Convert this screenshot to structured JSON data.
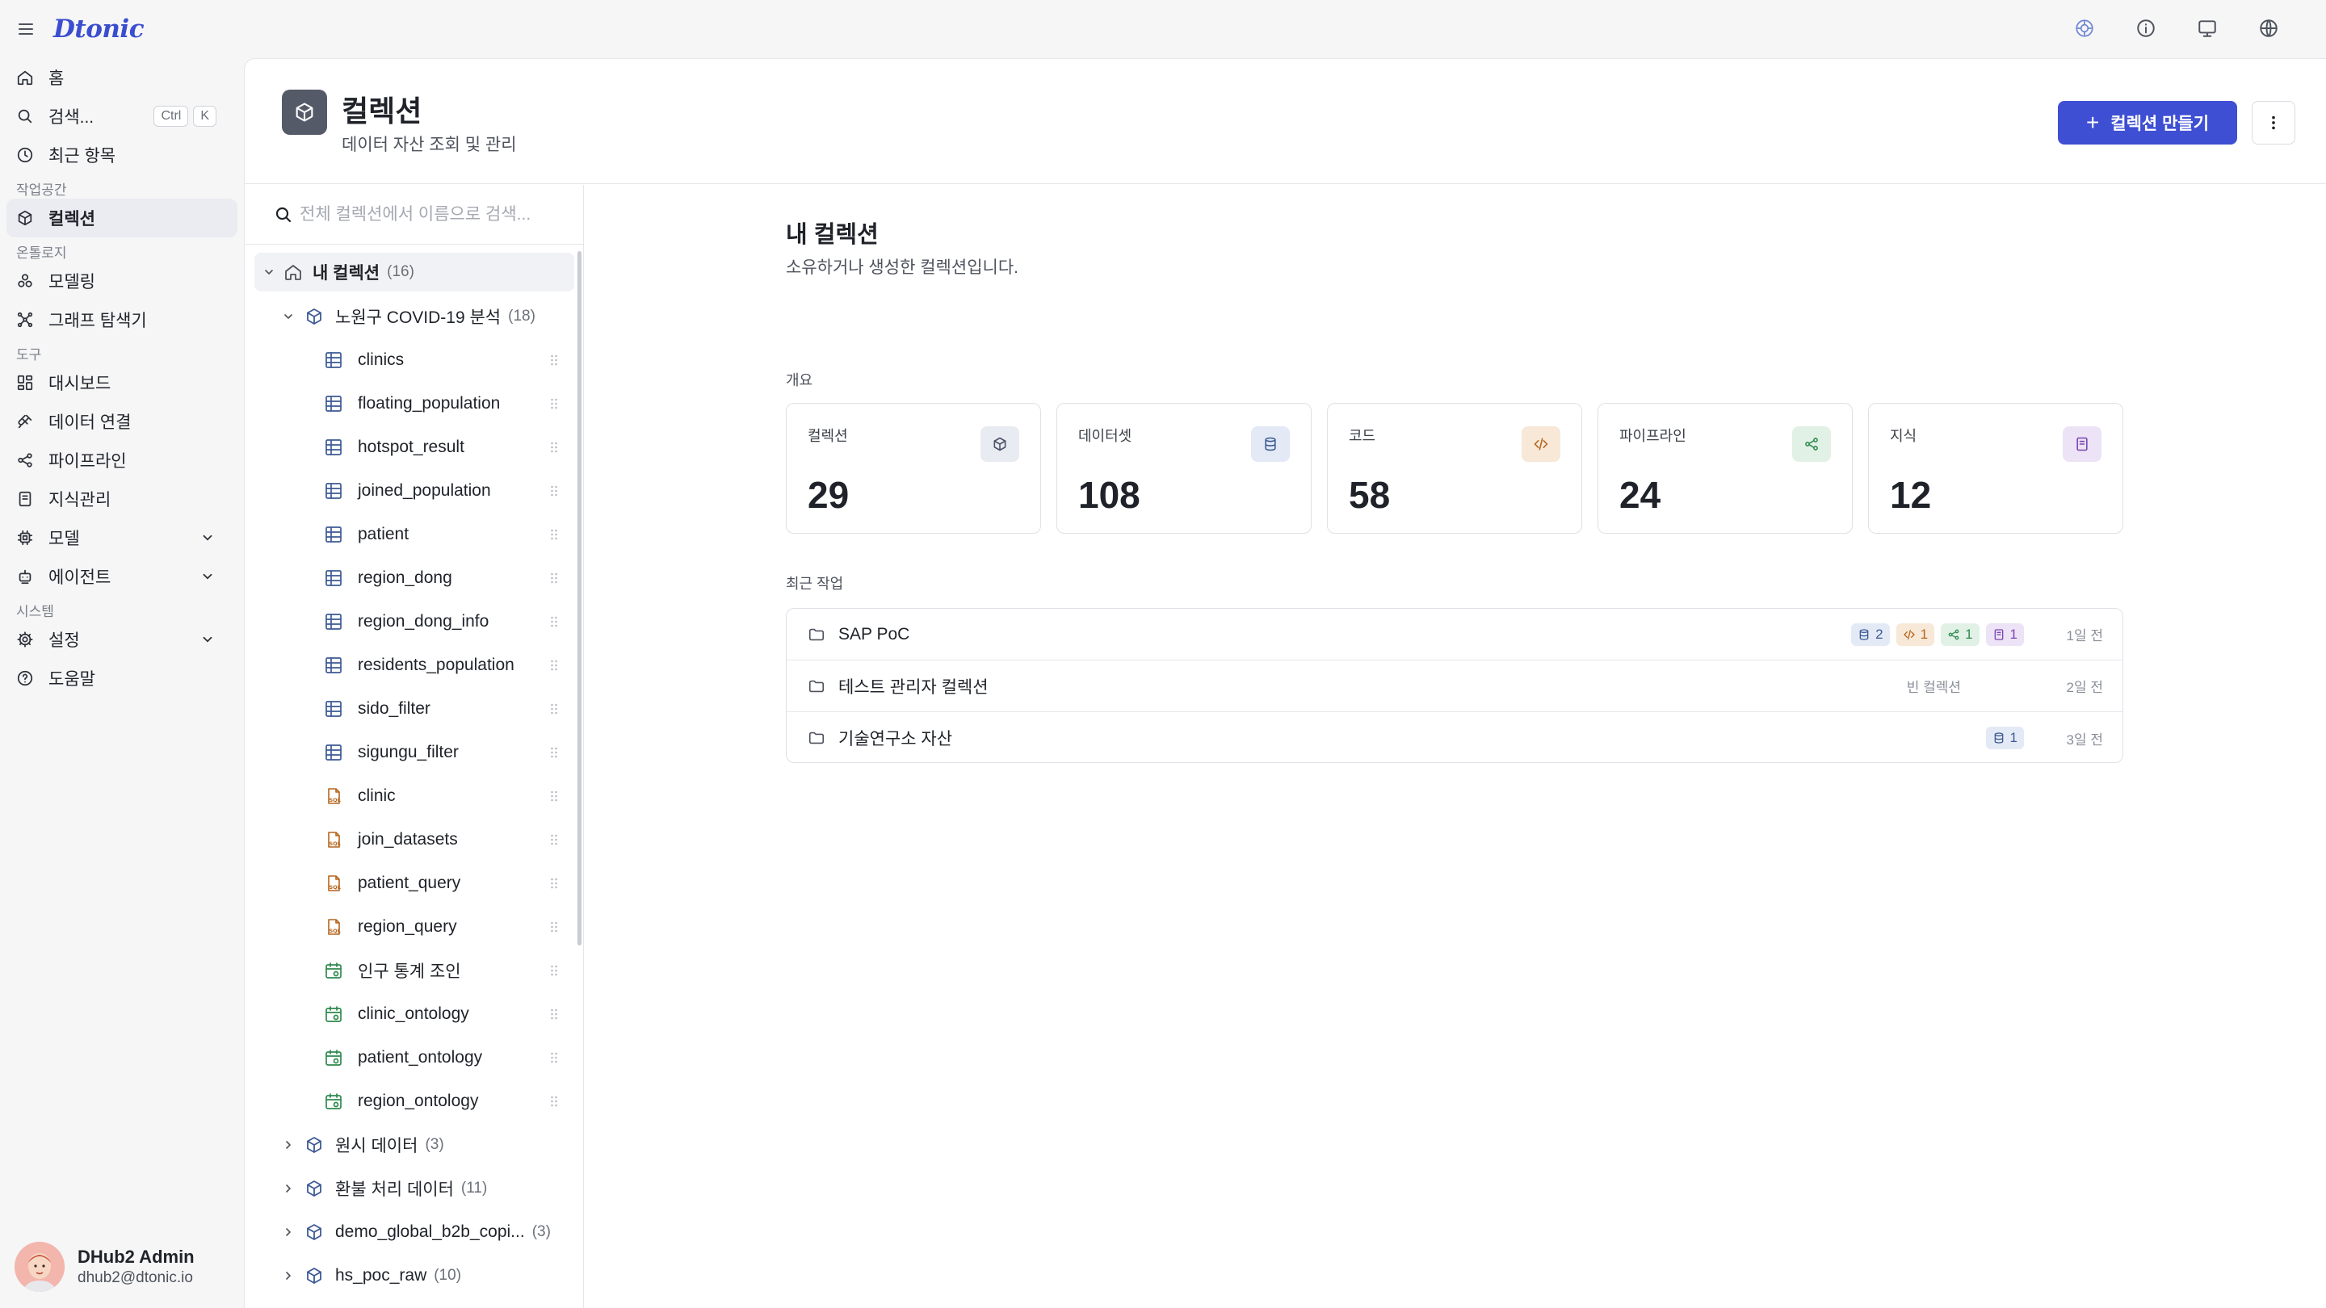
{
  "app": {
    "logo": "Dtonic"
  },
  "sidebar": {
    "nav_top": [
      {
        "label": "홈",
        "icon": "home-icon"
      },
      {
        "label": "검색...",
        "icon": "search-icon",
        "shortcut": [
          "Ctrl",
          "K"
        ]
      },
      {
        "label": "최근 항목",
        "icon": "clock-icon"
      }
    ],
    "section_workspace": "작업공간",
    "workspace_items": [
      {
        "label": "컬렉션",
        "icon": "cube-icon",
        "active": true
      }
    ],
    "section_ontology": "온톨로지",
    "ontology_items": [
      {
        "label": "모델링",
        "icon": "modeling-icon"
      },
      {
        "label": "그래프 탐색기",
        "icon": "graph-icon"
      }
    ],
    "section_tools": "도구",
    "tool_items": [
      {
        "label": "대시보드",
        "icon": "dashboard-icon"
      },
      {
        "label": "데이터 연결",
        "icon": "plug-icon"
      },
      {
        "label": "파이프라인",
        "icon": "pipeline-icon"
      },
      {
        "label": "지식관리",
        "icon": "book-icon"
      },
      {
        "label": "모델",
        "icon": "chip-icon",
        "expandable": true
      },
      {
        "label": "에이전트",
        "icon": "robot-icon",
        "expandable": true
      }
    ],
    "section_system": "시스템",
    "system_items": [
      {
        "label": "설정",
        "icon": "gear-icon",
        "expandable": true
      },
      {
        "label": "도움말",
        "icon": "help-icon"
      }
    ],
    "user": {
      "name": "DHub2 Admin",
      "email": "dhub2@dtonic.io"
    }
  },
  "header": {
    "title": "컬렉션",
    "subtitle": "데이터 자산 조회 및 관리",
    "create_label": "컬렉션 만들기"
  },
  "tree": {
    "search_placeholder": "전체 컬렉션에서 이름으로 검색...",
    "root": {
      "label": "내 컬렉션",
      "count": "(16)"
    },
    "open_collection": {
      "label": "노원구 COVID-19 분석",
      "count": "(18)"
    },
    "items": [
      {
        "label": "clinics",
        "type": "table"
      },
      {
        "label": "floating_population",
        "type": "table"
      },
      {
        "label": "hotspot_result",
        "type": "table"
      },
      {
        "label": "joined_population",
        "type": "table"
      },
      {
        "label": "patient",
        "type": "table"
      },
      {
        "label": "region_dong",
        "type": "table"
      },
      {
        "label": "region_dong_info",
        "type": "table"
      },
      {
        "label": "residents_population",
        "type": "table"
      },
      {
        "label": "sido_filter",
        "type": "table"
      },
      {
        "label": "sigungu_filter",
        "type": "table"
      },
      {
        "label": "clinic",
        "type": "sql"
      },
      {
        "label": "join_datasets",
        "type": "sql"
      },
      {
        "label": "patient_query",
        "type": "sql"
      },
      {
        "label": "region_query",
        "type": "sql"
      },
      {
        "label": "인구 통계 조인",
        "type": "pipeline"
      },
      {
        "label": "clinic_ontology",
        "type": "pipeline"
      },
      {
        "label": "patient_ontology",
        "type": "pipeline"
      },
      {
        "label": "region_ontology",
        "type": "pipeline"
      }
    ],
    "collapsed": [
      {
        "label": "원시 데이터",
        "count": "(3)"
      },
      {
        "label": "환불 처리 데이터",
        "count": "(11)"
      },
      {
        "label": "demo_global_b2b_copi...",
        "count": "(3)"
      },
      {
        "label": "hs_poc_raw",
        "count": "(10)"
      }
    ]
  },
  "content": {
    "title": "내 컬렉션",
    "subtitle": "소유하거나 생성한 컬렉션입니다.",
    "overview_label": "개요",
    "stats": [
      {
        "label": "컬렉션",
        "value": "29",
        "icon": "cube-icon",
        "bg": "#e8ebf2",
        "fg": "#4a5266"
      },
      {
        "label": "데이터셋",
        "value": "108",
        "icon": "database-icon",
        "bg": "#e3eaf6",
        "fg": "#3d5a94"
      },
      {
        "label": "코드",
        "value": "58",
        "icon": "code-icon",
        "bg": "#f7e8d8",
        "fg": "#b5651d"
      },
      {
        "label": "파이프라인",
        "value": "24",
        "icon": "share-icon",
        "bg": "#e1f1e6",
        "fg": "#2f8a4f"
      },
      {
        "label": "지식",
        "value": "12",
        "icon": "book-icon",
        "bg": "#ece3f6",
        "fg": "#7a45b3"
      }
    ],
    "recent_label": "최근 작업",
    "recent": [
      {
        "name": "SAP PoC",
        "time": "1일 전",
        "chips": [
          {
            "icon": "database-icon",
            "count": "2",
            "bg": "#e3eaf6",
            "fg": "#3d5a94"
          },
          {
            "icon": "code-icon",
            "count": "1",
            "bg": "#f7e8d8",
            "fg": "#b5651d"
          },
          {
            "icon": "share-icon",
            "count": "1",
            "bg": "#e1f1e6",
            "fg": "#2f8a4f"
          },
          {
            "icon": "book-icon",
            "count": "1",
            "bg": "#ece3f6",
            "fg": "#7a45b3"
          }
        ]
      },
      {
        "name": "테스트 관리자 컬렉션",
        "time": "2일 전",
        "empty": "빈 컬렉션",
        "chips": []
      },
      {
        "name": "기술연구소 자산",
        "time": "3일 전",
        "chips": [
          {
            "icon": "database-icon",
            "count": "1",
            "bg": "#e3eaf6",
            "fg": "#3d5a94"
          }
        ]
      }
    ]
  }
}
